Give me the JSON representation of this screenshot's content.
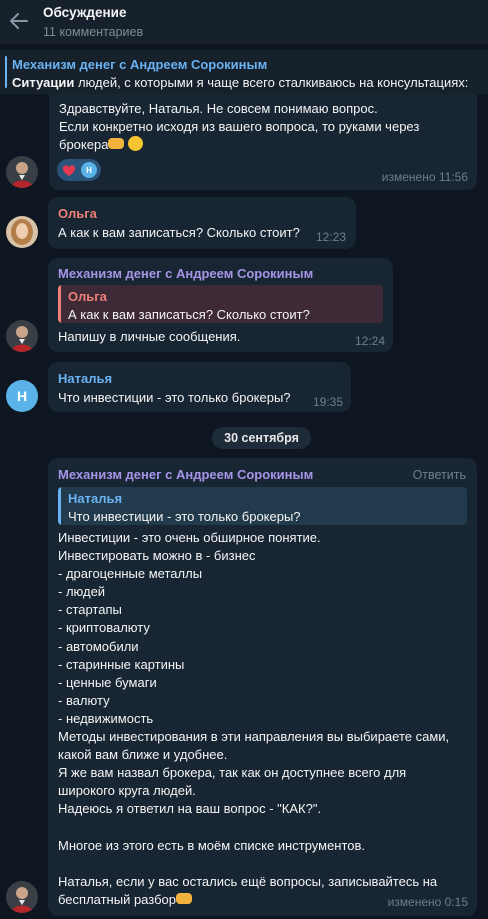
{
  "header": {
    "title": "Обсуждение",
    "subtitle": "11 комментариев"
  },
  "pinned": {
    "title": "Механизм денег с Андреем Сорокиным",
    "bold": "Ситуации",
    "text": " людей, с которыми я чаще всего сталкиваюсь на консультациях:"
  },
  "messages": {
    "m1": {
      "text_line1": "Здравствуйте, Наталья. Не совсем понимаю вопрос.",
      "text_line2": "Если конкретно исходя из вашего вопроса, то руками через",
      "text_line3": "брокера",
      "reaction_avatar_letter": "Н",
      "time": "изменено 11:56"
    },
    "m2": {
      "author": "Ольга",
      "text": "А как к вам записаться? Сколько стоит?",
      "time": "12:23"
    },
    "m3": {
      "author": "Механизм денег с Андреем Сорокиным",
      "reply_author": "Ольга",
      "reply_text": "А как к вам записаться? Сколько стоит?",
      "text": "Напишу в личные сообщения.",
      "time": "12:24"
    },
    "m4": {
      "author": "Наталья",
      "avatar_letter": "Н",
      "text": "Что инвестиции - это только брокеры?",
      "time": "19:35"
    },
    "date_separator": "30 сентября",
    "m5": {
      "author": "Механизм денег с Андреем Сорокиным",
      "reply_action": "Ответить",
      "reply_author": "Наталья",
      "reply_text": "Что инвестиции - это только брокеры?",
      "lines": [
        "Инвестиции - это очень обширное понятие.",
        "Инвестировать можно в - бизнес",
        "- драгоценные металлы",
        "- людей",
        "- стартапы",
        "- криптовалюту",
        "- автомобили",
        "- старинные картины",
        "- ценные бумаги",
        "- валюту",
        "- недвижимость",
        "Методы инвестирования в эти направления вы выбираете сами,",
        "какой вам ближе и удобнее.",
        "Я же вам назвал брокера, так как он доступнее всего для",
        "широкого круга людей.",
        "Надеюсь я ответил на ваш вопрос - \"КАК?\".",
        "",
        "Многое из этого есть в моём списке инструментов.",
        "",
        "Наталья, если у вас остались ещё вопросы, записывайтесь на",
        "бесплатный разбор"
      ],
      "time": "изменено 0:15"
    }
  },
  "colors": {
    "background": "#0e1621",
    "bubble": "#182533",
    "accent": "#6ab2f2",
    "channel_name": "#a695e7",
    "olga_name": "#ee7f77",
    "natalya_name": "#6ab2f2",
    "time": "#6d7f8f"
  }
}
